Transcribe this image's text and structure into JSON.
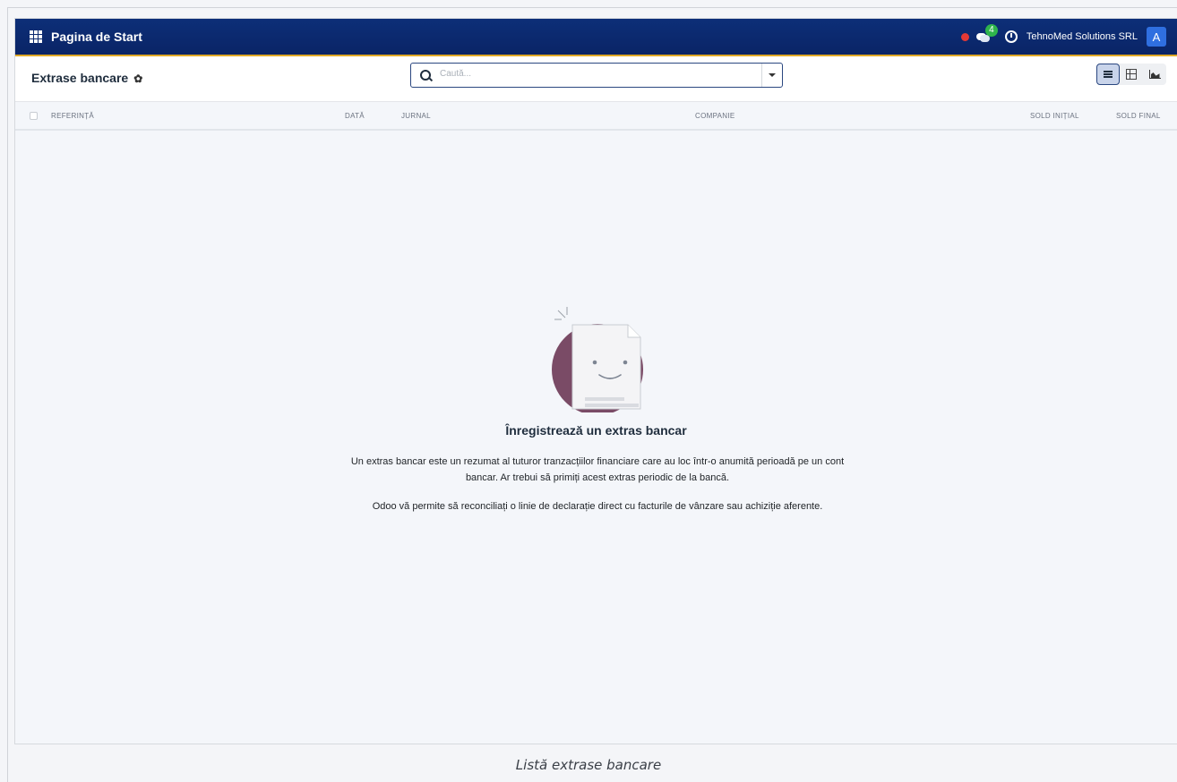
{
  "navbar": {
    "brand": "Pagina de Start",
    "chat_count": "4",
    "company": "TehnoMed Solutions SRL",
    "avatar_letter": "A",
    "colors": {
      "bar": "#0a2466",
      "accent": "#e0a826",
      "status_dot": "#e53935",
      "badge": "#2fb44c",
      "avatar": "#2f6fe0"
    }
  },
  "control": {
    "title": "Extrase bancare",
    "search_placeholder": "Caută...",
    "views": [
      {
        "icon": "list-view-icon",
        "active": true
      },
      {
        "icon": "pivot-view-icon",
        "active": false
      },
      {
        "icon": "graph-view-icon",
        "active": false
      }
    ]
  },
  "table": {
    "columns": [
      "REFERINȚĂ",
      "DATĂ",
      "JURNAL",
      "COMPANIE",
      "SOLD INIȚIAL",
      "SOLD FINAL"
    ]
  },
  "empty_state": {
    "title": "Înregistrează un extras bancar",
    "paragraph1": "Un extras bancar este un rezumat al tuturor tranzacțiilor financiare care au loc într-o anumită perioadă pe un cont bancar. Ar trebui să primiți acest extras periodic de la bancă.",
    "paragraph2": "Odoo vă permite să reconciliați o linie de declarație direct cu facturile de vânzare sau achiziție aferente."
  },
  "caption": "Listă extrase bancare"
}
